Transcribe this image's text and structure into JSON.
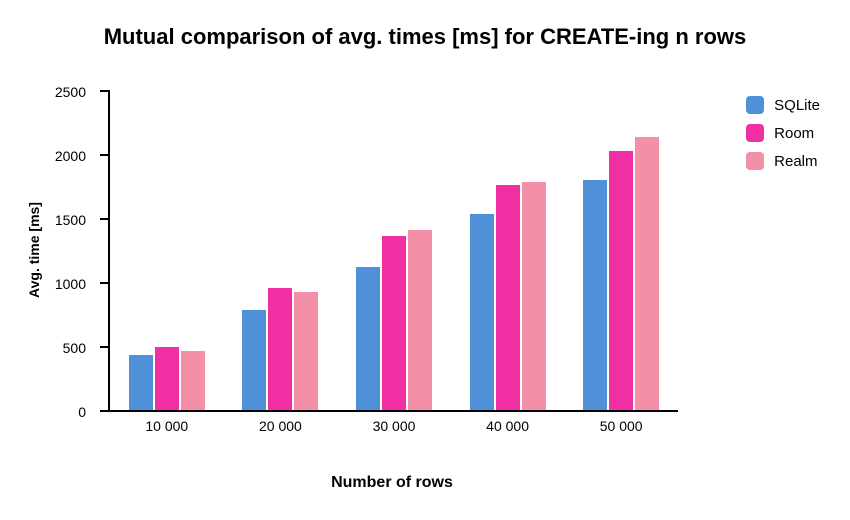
{
  "chart_data": {
    "type": "bar",
    "title": "Mutual comparison of avg. times [ms] for CREATE-ing n rows",
    "xlabel": "Number of rows",
    "ylabel": "Avg. time [ms]",
    "ylim": [
      0,
      2500
    ],
    "yticks": [
      0,
      500,
      1000,
      1500,
      2000,
      2500
    ],
    "categories": [
      "10 000",
      "20 000",
      "30 000",
      "40 000",
      "50 000"
    ],
    "series": [
      {
        "name": "SQLite",
        "color": "#4f90d9",
        "values": [
          430,
          780,
          1120,
          1530,
          1800
        ]
      },
      {
        "name": "Room",
        "color": "#ef2fa2",
        "values": [
          490,
          950,
          1360,
          1760,
          2020
        ]
      },
      {
        "name": "Realm",
        "color": "#f38fa6",
        "values": [
          460,
          920,
          1410,
          1780,
          2130
        ]
      }
    ],
    "legend_position": "right"
  }
}
